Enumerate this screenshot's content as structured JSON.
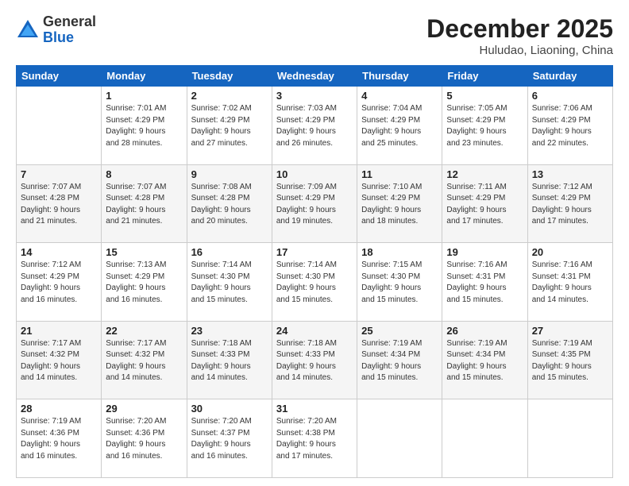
{
  "header": {
    "logo_line1": "General",
    "logo_line2": "Blue",
    "month_year": "December 2025",
    "location": "Huludao, Liaoning, China"
  },
  "days_of_week": [
    "Sunday",
    "Monday",
    "Tuesday",
    "Wednesday",
    "Thursday",
    "Friday",
    "Saturday"
  ],
  "weeks": [
    [
      {
        "num": "",
        "detail": ""
      },
      {
        "num": "1",
        "detail": "Sunrise: 7:01 AM\nSunset: 4:29 PM\nDaylight: 9 hours\nand 28 minutes."
      },
      {
        "num": "2",
        "detail": "Sunrise: 7:02 AM\nSunset: 4:29 PM\nDaylight: 9 hours\nand 27 minutes."
      },
      {
        "num": "3",
        "detail": "Sunrise: 7:03 AM\nSunset: 4:29 PM\nDaylight: 9 hours\nand 26 minutes."
      },
      {
        "num": "4",
        "detail": "Sunrise: 7:04 AM\nSunset: 4:29 PM\nDaylight: 9 hours\nand 25 minutes."
      },
      {
        "num": "5",
        "detail": "Sunrise: 7:05 AM\nSunset: 4:29 PM\nDaylight: 9 hours\nand 23 minutes."
      },
      {
        "num": "6",
        "detail": "Sunrise: 7:06 AM\nSunset: 4:29 PM\nDaylight: 9 hours\nand 22 minutes."
      }
    ],
    [
      {
        "num": "7",
        "detail": "Sunrise: 7:07 AM\nSunset: 4:28 PM\nDaylight: 9 hours\nand 21 minutes."
      },
      {
        "num": "8",
        "detail": "Sunrise: 7:07 AM\nSunset: 4:28 PM\nDaylight: 9 hours\nand 21 minutes."
      },
      {
        "num": "9",
        "detail": "Sunrise: 7:08 AM\nSunset: 4:28 PM\nDaylight: 9 hours\nand 20 minutes."
      },
      {
        "num": "10",
        "detail": "Sunrise: 7:09 AM\nSunset: 4:29 PM\nDaylight: 9 hours\nand 19 minutes."
      },
      {
        "num": "11",
        "detail": "Sunrise: 7:10 AM\nSunset: 4:29 PM\nDaylight: 9 hours\nand 18 minutes."
      },
      {
        "num": "12",
        "detail": "Sunrise: 7:11 AM\nSunset: 4:29 PM\nDaylight: 9 hours\nand 17 minutes."
      },
      {
        "num": "13",
        "detail": "Sunrise: 7:12 AM\nSunset: 4:29 PM\nDaylight: 9 hours\nand 17 minutes."
      }
    ],
    [
      {
        "num": "14",
        "detail": "Sunrise: 7:12 AM\nSunset: 4:29 PM\nDaylight: 9 hours\nand 16 minutes."
      },
      {
        "num": "15",
        "detail": "Sunrise: 7:13 AM\nSunset: 4:29 PM\nDaylight: 9 hours\nand 16 minutes."
      },
      {
        "num": "16",
        "detail": "Sunrise: 7:14 AM\nSunset: 4:30 PM\nDaylight: 9 hours\nand 15 minutes."
      },
      {
        "num": "17",
        "detail": "Sunrise: 7:14 AM\nSunset: 4:30 PM\nDaylight: 9 hours\nand 15 minutes."
      },
      {
        "num": "18",
        "detail": "Sunrise: 7:15 AM\nSunset: 4:30 PM\nDaylight: 9 hours\nand 15 minutes."
      },
      {
        "num": "19",
        "detail": "Sunrise: 7:16 AM\nSunset: 4:31 PM\nDaylight: 9 hours\nand 15 minutes."
      },
      {
        "num": "20",
        "detail": "Sunrise: 7:16 AM\nSunset: 4:31 PM\nDaylight: 9 hours\nand 14 minutes."
      }
    ],
    [
      {
        "num": "21",
        "detail": "Sunrise: 7:17 AM\nSunset: 4:32 PM\nDaylight: 9 hours\nand 14 minutes."
      },
      {
        "num": "22",
        "detail": "Sunrise: 7:17 AM\nSunset: 4:32 PM\nDaylight: 9 hours\nand 14 minutes."
      },
      {
        "num": "23",
        "detail": "Sunrise: 7:18 AM\nSunset: 4:33 PM\nDaylight: 9 hours\nand 14 minutes."
      },
      {
        "num": "24",
        "detail": "Sunrise: 7:18 AM\nSunset: 4:33 PM\nDaylight: 9 hours\nand 14 minutes."
      },
      {
        "num": "25",
        "detail": "Sunrise: 7:19 AM\nSunset: 4:34 PM\nDaylight: 9 hours\nand 15 minutes."
      },
      {
        "num": "26",
        "detail": "Sunrise: 7:19 AM\nSunset: 4:34 PM\nDaylight: 9 hours\nand 15 minutes."
      },
      {
        "num": "27",
        "detail": "Sunrise: 7:19 AM\nSunset: 4:35 PM\nDaylight: 9 hours\nand 15 minutes."
      }
    ],
    [
      {
        "num": "28",
        "detail": "Sunrise: 7:19 AM\nSunset: 4:36 PM\nDaylight: 9 hours\nand 16 minutes."
      },
      {
        "num": "29",
        "detail": "Sunrise: 7:20 AM\nSunset: 4:36 PM\nDaylight: 9 hours\nand 16 minutes."
      },
      {
        "num": "30",
        "detail": "Sunrise: 7:20 AM\nSunset: 4:37 PM\nDaylight: 9 hours\nand 16 minutes."
      },
      {
        "num": "31",
        "detail": "Sunrise: 7:20 AM\nSunset: 4:38 PM\nDaylight: 9 hours\nand 17 minutes."
      },
      {
        "num": "",
        "detail": ""
      },
      {
        "num": "",
        "detail": ""
      },
      {
        "num": "",
        "detail": ""
      }
    ]
  ]
}
